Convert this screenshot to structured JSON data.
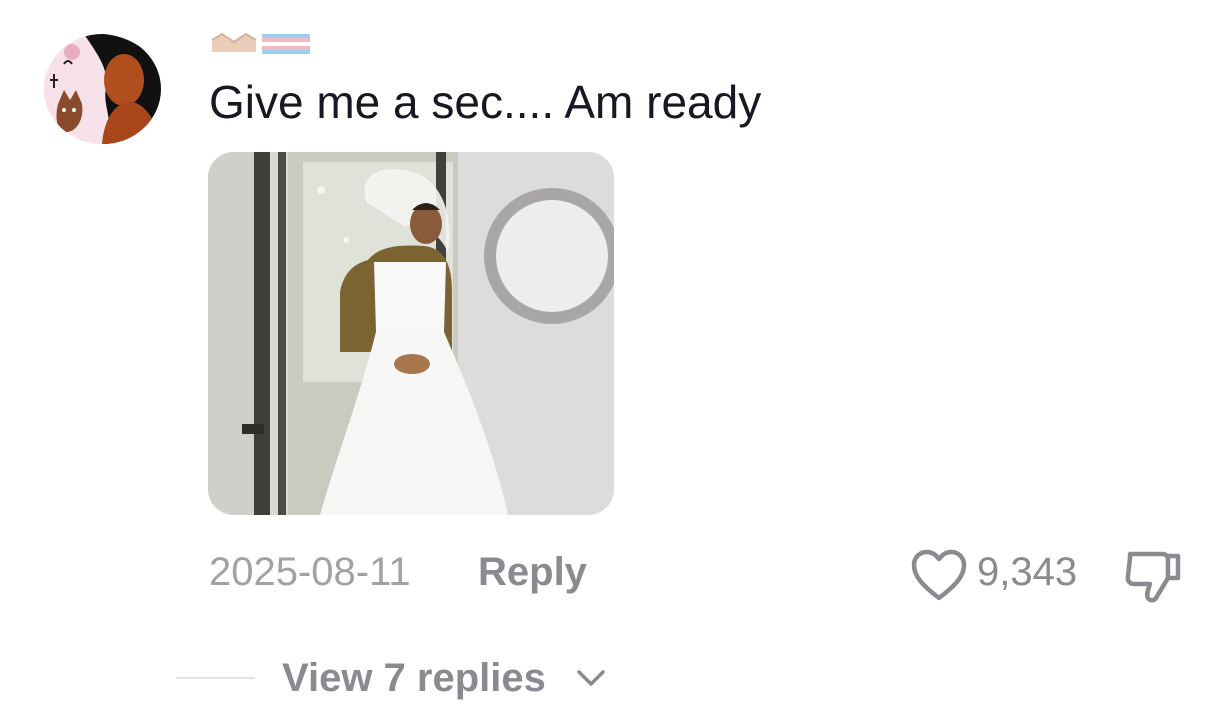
{
  "comment": {
    "text": "Give me a sec.... Am ready",
    "date": "2025-08-11",
    "reply_label": "Reply",
    "like_count": "9,343",
    "view_replies_label": "View 7 replies"
  },
  "icons": {
    "like": "heart-outline-icon",
    "dislike": "thumbs-down-outline-icon",
    "expand": "chevron-down-icon"
  },
  "colors": {
    "text_primary": "#161823",
    "text_secondary": "#8a8b91",
    "text_muted": "#a2a2a6",
    "divider": "#e3e3e4"
  }
}
